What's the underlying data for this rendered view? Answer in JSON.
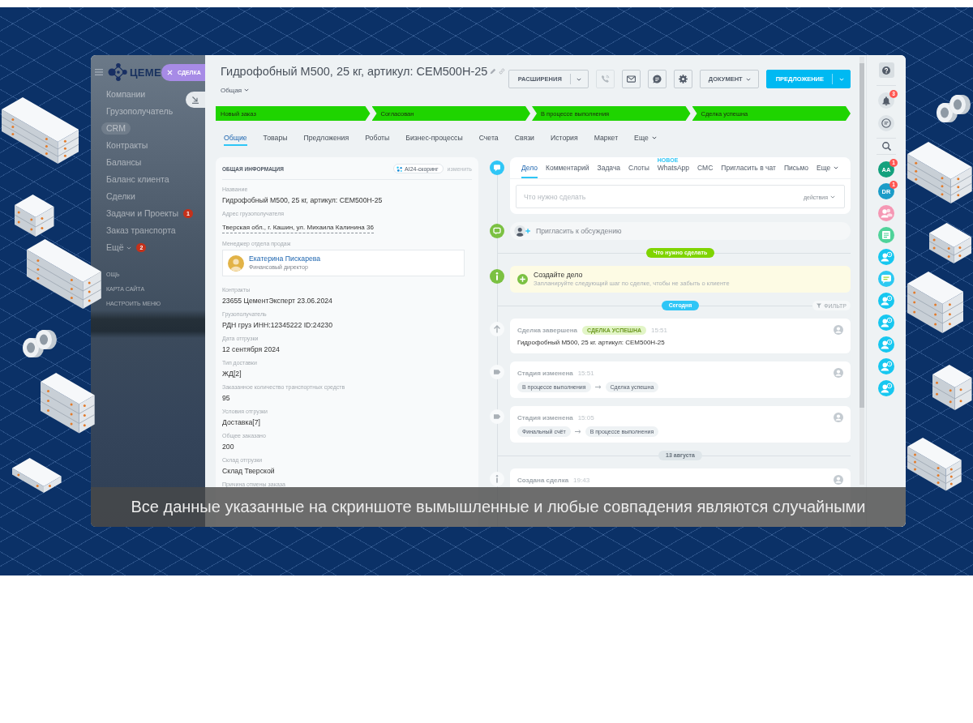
{
  "sidebar": {
    "logo": "ЦЕМЕ",
    "items": [
      {
        "label": "Компании",
        "selected": false,
        "kind": "link"
      },
      {
        "label": "Грузополучатель",
        "selected": false,
        "kind": "link"
      },
      {
        "label": "CRM",
        "selected": true,
        "kind": "link"
      },
      {
        "label": "Контракты",
        "selected": false,
        "kind": "link"
      },
      {
        "label": "Балансы",
        "selected": false,
        "kind": "link"
      },
      {
        "label": "Баланс клиента",
        "selected": false,
        "kind": "link"
      },
      {
        "label": "Сделки",
        "selected": false,
        "kind": "link"
      },
      {
        "label": "Задачи и Проекты",
        "selected": false,
        "kind": "link",
        "badge": "1"
      },
      {
        "label": "Заказ транспорта",
        "selected": false,
        "kind": "link"
      },
      {
        "label": "Ещё",
        "selected": false,
        "kind": "menu",
        "badge": "2"
      }
    ],
    "links": [
      "ОЩЬ",
      "КАРТА САЙТА",
      "НАСТРОИТЬ МЕНЮ"
    ]
  },
  "slider": {
    "label": "СДЕЛКА"
  },
  "header": {
    "title": "Гидрофобный М500, 25 кг, артикул: CEM500H-25",
    "category": "Общая",
    "toolbar": [
      {
        "kind": "split",
        "label": "РАСШИРЕНИЯ",
        "primary": false
      },
      {
        "kind": "icon",
        "disabled": true
      },
      {
        "kind": "icon",
        "disabled": false
      },
      {
        "kind": "icon",
        "disabled": false
      },
      {
        "kind": "icon",
        "disabled": false
      },
      {
        "kind": "menu",
        "label": "ДОКУМЕНТ"
      },
      {
        "kind": "split",
        "label": "ПРЕДЛОЖЕНИЕ",
        "primary": true
      }
    ]
  },
  "stages": [
    {
      "label": "Новый заказ",
      "done": true
    },
    {
      "label": "Согласован",
      "done": true
    },
    {
      "label": "В процессе выполнения",
      "done": true
    },
    {
      "label": "Сделка успешна",
      "done": true
    }
  ],
  "tabs": [
    {
      "label": "Общие",
      "selected": true,
      "kind": "tab"
    },
    {
      "label": "Товары",
      "selected": false,
      "kind": "tab"
    },
    {
      "label": "Предложения",
      "selected": false,
      "kind": "tab"
    },
    {
      "label": "Роботы",
      "selected": false,
      "kind": "tab"
    },
    {
      "label": "Бизнес-процессы",
      "selected": false,
      "kind": "tab"
    },
    {
      "label": "Счета",
      "selected": false,
      "kind": "tab"
    },
    {
      "label": "Связи",
      "selected": false,
      "kind": "tab"
    },
    {
      "label": "История",
      "selected": false,
      "kind": "tab"
    },
    {
      "label": "Маркет",
      "selected": false,
      "kind": "tab"
    },
    {
      "label": "Еще",
      "selected": false,
      "kind": "menu"
    }
  ],
  "info": {
    "title": "ОБЩАЯ ИНФОРМАЦИЯ",
    "scoring": "AI24-скоринг",
    "edit": "изменить",
    "fields": [
      {
        "kind": "text",
        "label": "Название",
        "value": "Гидрофобный М500, 25 кг, артикул: CEM500H-25"
      },
      {
        "kind": "address",
        "label": "Адрес грузополучателя",
        "value": "Тверская обл., г. Кашин, ул. Михаила Калинина 36"
      },
      {
        "kind": "person",
        "label": "Менеджер отдела продаж",
        "name": "Екатерина Пискарева",
        "role": "Финансовый директор"
      },
      {
        "kind": "text",
        "label": "Контракты",
        "value": "23655 ЦементЭксперт 23.06.2024"
      },
      {
        "kind": "text",
        "label": "Грузополучатель",
        "value": "РДН груз ИНН:12345222 ID:24230"
      },
      {
        "kind": "text",
        "label": "Дата отгрузки",
        "value": "12 сентября 2024"
      },
      {
        "kind": "text",
        "label": "Тип доставки",
        "value": "ЖД[2]"
      },
      {
        "kind": "text",
        "label": "Заказанное количество транспортных средств",
        "value": "95"
      },
      {
        "kind": "text",
        "label": "Условия отгрузки",
        "value": "Доставка[7]"
      },
      {
        "kind": "text",
        "label": "Общее заказано",
        "value": "200"
      },
      {
        "kind": "text",
        "label": "Склад отгрузки",
        "value": "Склад Тверской"
      },
      {
        "kind": "text",
        "label": "Причина отмены заказа"
      }
    ]
  },
  "timeline": {
    "composer": {
      "tabs": [
        {
          "label": "Дело",
          "selected": true,
          "kind": "tab"
        },
        {
          "label": "Комментарий",
          "selected": false,
          "kind": "tab"
        },
        {
          "label": "Задача",
          "selected": false,
          "kind": "tab"
        },
        {
          "label": "Слоты",
          "selected": false,
          "kind": "tab"
        },
        {
          "label": "WhatsApp",
          "selected": false,
          "kind": "tab",
          "badge": "НОВОЕ"
        },
        {
          "label": "СМС",
          "selected": false,
          "kind": "tab"
        },
        {
          "label": "Пригласить в чат",
          "selected": false,
          "kind": "tab"
        },
        {
          "label": "Письмо",
          "selected": false,
          "kind": "tab"
        },
        {
          "label": "Еще",
          "selected": false,
          "kind": "menu"
        }
      ],
      "placeholder": "Что нужно сделать",
      "actions": "действия"
    },
    "invite": "Пригласить к обсуждению",
    "items": [
      {
        "kind": "section",
        "label": "Что нужно сделать",
        "color": "#7fd400"
      },
      {
        "kind": "reminder",
        "title": "Создайте дело",
        "text": "Запланируйте следующий шаг по сделке, чтобы не забыть о клиенте"
      },
      {
        "kind": "section",
        "label": "Сегодня",
        "color": "#2fc6f6",
        "filter": "ФИЛЬТР"
      },
      {
        "kind": "completed",
        "title": "Сделка завершена",
        "badge": "СДЕЛКА УСПЕШНА",
        "time": "15:51",
        "text": "Гидрофобный М500, 25 кг. артикул: CEM500H-25"
      },
      {
        "kind": "stage",
        "title": "Стадия изменена",
        "time": "15:51",
        "from": "В процессе выполнения",
        "to": "Сделка успешна"
      },
      {
        "kind": "stage",
        "title": "Стадия изменена",
        "time": "15:05",
        "from": "Финальный счёт",
        "to": "В процессе выполнения"
      },
      {
        "kind": "section",
        "label": "13 августа",
        "color": "#dfe6ea"
      },
      {
        "kind": "created",
        "title": "Создана сделка",
        "time": "19:43"
      }
    ]
  },
  "rail": {
    "notifications": "3",
    "contacts": [
      {
        "initials": "AA",
        "badge": "1",
        "color": "#13a17d"
      },
      {
        "initials": "DR",
        "badge": "1",
        "color": "#1b9cc8"
      }
    ]
  },
  "caption": "Все данные указанные на скриншоте вымышленные и любые совпадения являются случайными"
}
